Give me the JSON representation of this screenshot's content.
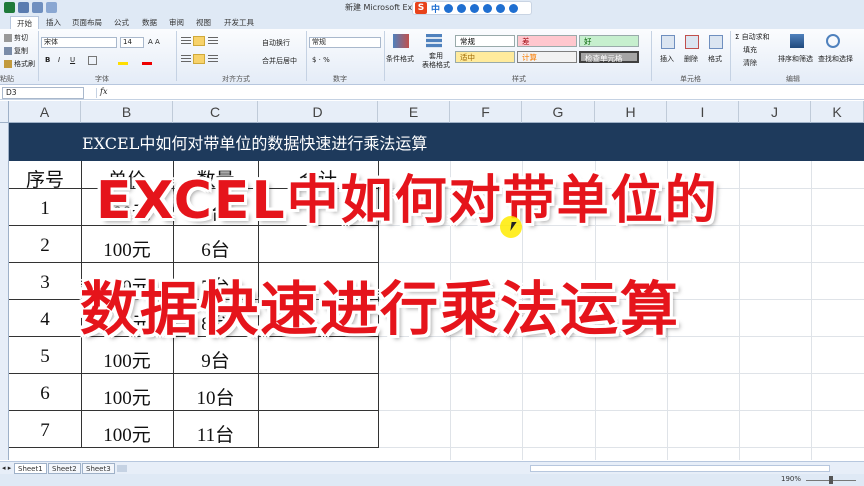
{
  "window": {
    "title": "新建 Microsoft Exce",
    "ime": {
      "logo": "S",
      "mode": "中"
    }
  },
  "ribbon_tabs": [
    "开始",
    "插入",
    "页面布局",
    "公式",
    "数据",
    "审阅",
    "视图",
    "开发工具"
  ],
  "ribbon": {
    "clipboard": {
      "cut": "剪切",
      "copy": "复制",
      "painter": "格式刷",
      "group": "粘贴"
    },
    "font": {
      "name": "宋体",
      "size": "14",
      "group": "字体"
    },
    "alignment": {
      "wrap": "自动换行",
      "merge": "合并后居中",
      "group": "对齐方式"
    },
    "number": {
      "format": "常规",
      "group": "数字"
    },
    "styles": {
      "conditional": "条件格式",
      "table": "套用\n表格格式",
      "cells": [
        {
          "label": "常规",
          "bg": "#ffffff"
        },
        {
          "label": "差",
          "bg": "#ffc7ce"
        },
        {
          "label": "好",
          "bg": "#c6efce"
        },
        {
          "label": "适中",
          "bg": "#ffeb9c"
        },
        {
          "label": "计算",
          "bg": "#f2f2f2"
        },
        {
          "label": "检查单元格",
          "bg": "#a5a5a5"
        }
      ],
      "group": "样式"
    },
    "cells_group": {
      "insert": "插入",
      "delete": "删除",
      "format": "格式",
      "group": "单元格"
    },
    "editing": {
      "autosum": "Σ 自动求和",
      "fill": "填充",
      "clear": "清除",
      "sort": "排序和筛选",
      "find": "查找和选择",
      "group": "编辑"
    }
  },
  "formula_bar": {
    "cell_ref": "D3",
    "fx": "fx"
  },
  "columns": [
    "A",
    "B",
    "C",
    "D",
    "E",
    "F",
    "G",
    "H",
    "I",
    "J",
    "K"
  ],
  "banner": {
    "text": "EXCEL中如何对带单位的数据快速进行乘法运算",
    "bg": "#1e3a5c"
  },
  "table": {
    "headers": [
      "序号",
      "单价",
      "数量",
      "合计"
    ],
    "rows": [
      [
        "1",
        "100元",
        "5台"
      ],
      [
        "2",
        "100元",
        "6台"
      ],
      [
        "3",
        "100元",
        "7台"
      ],
      [
        "4",
        "100元",
        "8台"
      ],
      [
        "5",
        "100元",
        "9台"
      ],
      [
        "6",
        "100元",
        "10台"
      ],
      [
        "7",
        "100元",
        "11台"
      ]
    ]
  },
  "overlay": {
    "line1": "EXCEL中如何对带单位的",
    "line2": "数据快速进行乘法运算",
    "color": "#e5141b"
  },
  "sheets": [
    "Sheet1",
    "Sheet2",
    "Sheet3"
  ],
  "status": {
    "zoom": "190%"
  }
}
